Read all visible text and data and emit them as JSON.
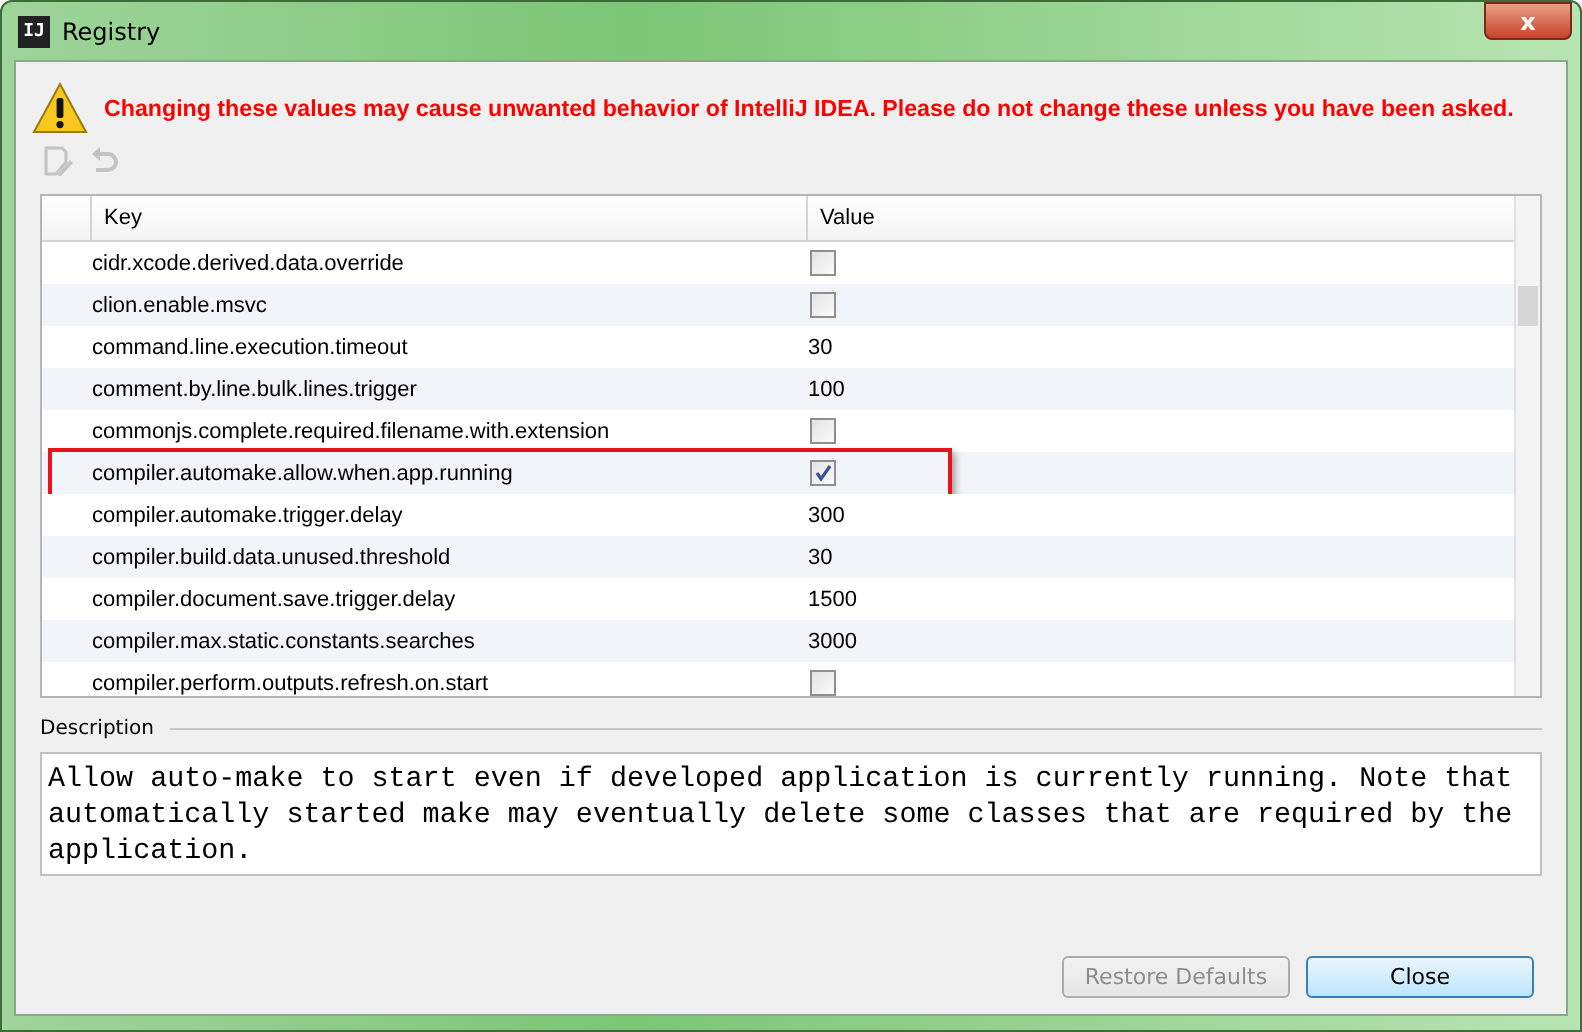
{
  "window": {
    "title": "Registry",
    "icon_text": "IJ",
    "close_glyph": "x"
  },
  "warning": "Changing these values may cause unwanted behavior of IntelliJ IDEA. Please do not change these unless you have been asked.",
  "toolbar": [
    {
      "kind": "edit",
      "disabled": true
    },
    {
      "kind": "revert",
      "disabled": true
    }
  ],
  "table": {
    "columns": [
      "Key",
      "Value"
    ],
    "rows": [
      {
        "key": "cidr.xcode.derived.data.override",
        "kind": "checkbox",
        "checked": false,
        "highlighted": false
      },
      {
        "key": "clion.enable.msvc",
        "kind": "checkbox",
        "checked": false,
        "highlighted": false
      },
      {
        "key": "command.line.execution.timeout",
        "kind": "text",
        "value": "30",
        "highlighted": false
      },
      {
        "key": "comment.by.line.bulk.lines.trigger",
        "kind": "text",
        "value": "100",
        "highlighted": false
      },
      {
        "key": "commonjs.complete.required.filename.with.extension",
        "kind": "checkbox",
        "checked": false,
        "highlighted": false
      },
      {
        "key": "compiler.automake.allow.when.app.running",
        "kind": "checkbox",
        "checked": true,
        "highlighted": true
      },
      {
        "key": "compiler.automake.trigger.delay",
        "kind": "text",
        "value": "300",
        "highlighted": false
      },
      {
        "key": "compiler.build.data.unused.threshold",
        "kind": "text",
        "value": "30",
        "highlighted": false
      },
      {
        "key": "compiler.document.save.trigger.delay",
        "kind": "text",
        "value": "1500",
        "highlighted": false
      },
      {
        "key": "compiler.max.static.constants.searches",
        "kind": "text",
        "value": "3000",
        "highlighted": false
      },
      {
        "key": "compiler.perform.outputs.refresh.on.start",
        "kind": "checkbox",
        "checked": false,
        "highlighted": false
      }
    ]
  },
  "description": {
    "label": "Description",
    "text": "Allow auto-make to start even if developed application is currently running. Note that automatically started make may eventually delete some classes that are required by the application."
  },
  "buttons": [
    {
      "label": "Restore Defaults",
      "disabled": true,
      "default": false
    },
    {
      "label": "Close",
      "disabled": false,
      "default": true
    }
  ]
}
